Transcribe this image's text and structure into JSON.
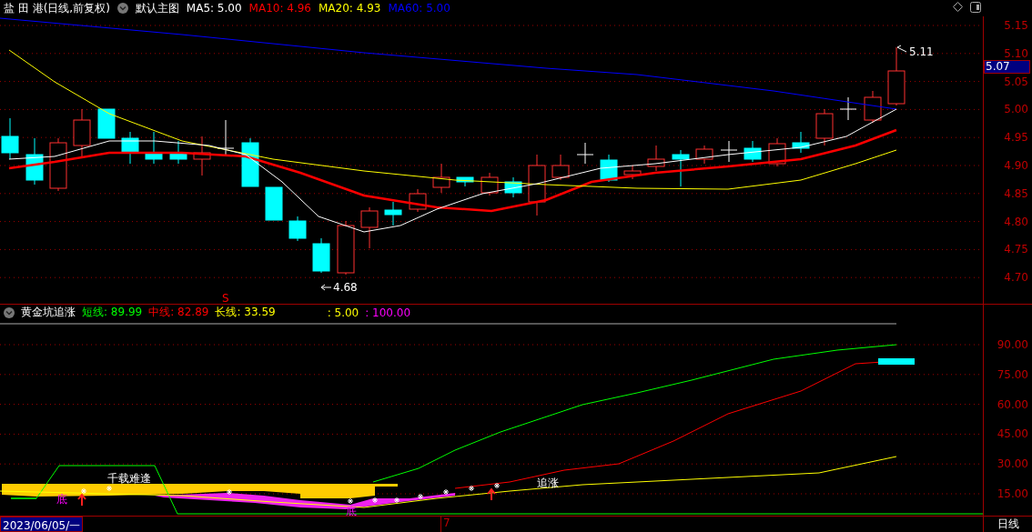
{
  "header": {
    "title": "盐 田 港(日线,前复权)",
    "template": "默认主图",
    "ma_labels": [
      {
        "label": "MA5: 5.00",
        "color": "#ffffff"
      },
      {
        "label": "MA10: 4.96",
        "color": "#ff0000"
      },
      {
        "label": "MA20: 4.93",
        "color": "#ffff00"
      },
      {
        "label": "MA60: 5.00",
        "color": "#0000ff"
      }
    ]
  },
  "main_chart": {
    "annotations": [
      {
        "kind": "high",
        "text": "5.11"
      },
      {
        "kind": "low",
        "text": "4.68"
      },
      {
        "kind": "signal",
        "text": "S"
      }
    ]
  },
  "main_axis": {
    "ticks": [
      "5.15",
      "5.10",
      "5.05",
      "5.00",
      "4.95",
      "4.90",
      "4.85",
      "4.80",
      "4.75",
      "4.70"
    ],
    "price_tag": "5.07"
  },
  "indicator": {
    "name": "黄金坑追涨",
    "values": [
      {
        "label": "短线: 89.99",
        "color": "#00ff00"
      },
      {
        "label": "中线: 82.89",
        "color": "#ff0000"
      },
      {
        "label": "长线: 33.59",
        "color": "#ffff00"
      },
      {
        "label": ": 5.00",
        "color": "#ffff00"
      },
      {
        "label": ": 100.00",
        "color": "#ff00ff"
      }
    ],
    "annotations": [
      {
        "kind": "label",
        "text": "千载难逢"
      },
      {
        "kind": "label",
        "text": "追涨"
      },
      {
        "kind": "bottom",
        "text": "底"
      },
      {
        "kind": "bottom",
        "text": "底"
      }
    ]
  },
  "indicator_axis": {
    "ticks": [
      "90.00",
      "75.00",
      "60.00",
      "45.00",
      "30.00",
      "15.00"
    ]
  },
  "bottom_bar": {
    "date": "2023/06/05/一",
    "marker": "7",
    "period": "日线"
  }
}
